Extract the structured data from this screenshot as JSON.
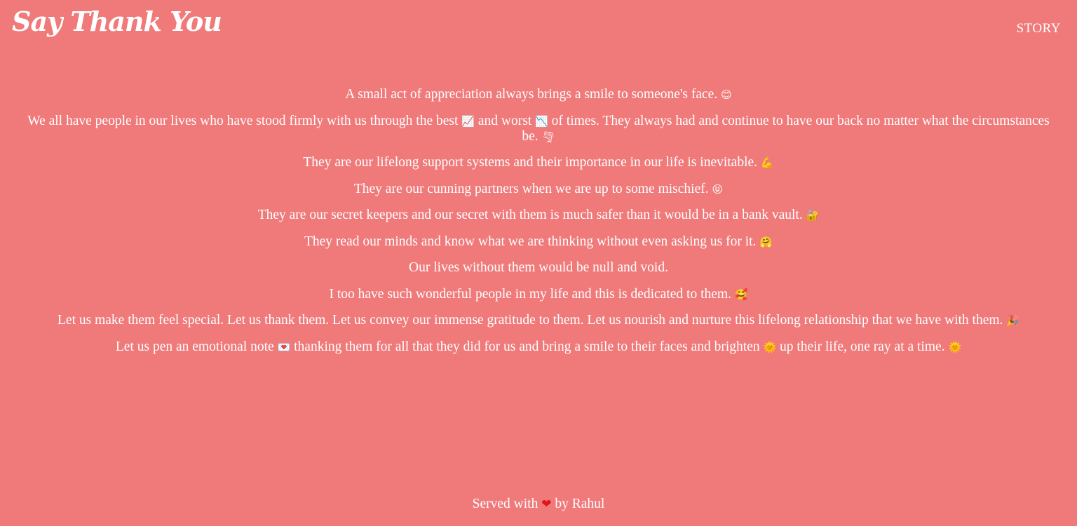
{
  "header": {
    "brand": "Say Thank You",
    "nav_story": "STORY"
  },
  "story": {
    "p1": {
      "text": "A small act of appreciation always brings a smile to someone's face.",
      "emoji": "😊"
    },
    "p2": {
      "part1": "We all have people in our lives who have stood firmly with us through the best",
      "emoji1": "📈",
      "part2": "and worst",
      "emoji2": "📉",
      "part3": "of times. They always had and continue to have our back no matter what the circumstances be.",
      "emoji3": "🌪"
    },
    "p3": {
      "text": "They are our lifelong support systems and their importance in our life is inevitable.",
      "emoji": "💪"
    },
    "p4": {
      "text": "They are our cunning partners when we are up to some mischief.",
      "emoji": "😝"
    },
    "p5": {
      "text": "They are our secret keepers and our secret with them is much safer than it would be in a bank vault.",
      "emoji": "🔐"
    },
    "p6": {
      "text": "They read our minds and know what we are thinking without even asking us for it.",
      "emoji": "🤗"
    },
    "p7": {
      "text": "Our lives without them would be null and void."
    },
    "p8": {
      "text": "I too have such wonderful people in my life and this is dedicated to them.",
      "emoji": "🥰"
    },
    "p9": {
      "text": "Let us make them feel special. Let us thank them. Let us convey our immense gratitude to them. Let us nourish and nurture this lifelong relationship that we have with them.",
      "emoji": "🎉"
    },
    "p10": {
      "part1": "Let us pen an emotional note",
      "emoji1": "💌",
      "part2": "thanking them for all that they did for us and bring a smile to their faces and brighten",
      "emoji2": "🌞",
      "part3": "up their life, one ray at a time.",
      "emoji3": "🌞"
    }
  },
  "footer": {
    "prefix": "Served with",
    "heart": "❤",
    "suffix": "by Rahul"
  }
}
